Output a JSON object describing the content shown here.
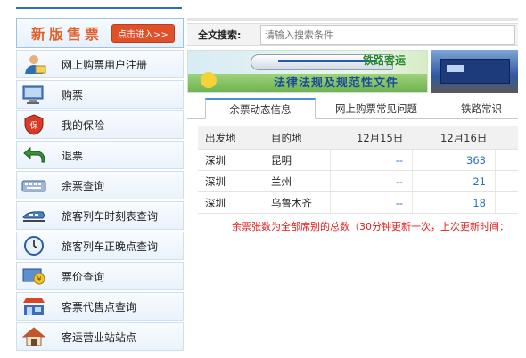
{
  "sidebar": {
    "brand_title": "新版售票",
    "brand_button": "点击进入>>",
    "items": [
      {
        "label": "网上购票用户注册",
        "icon": "user-register-icon"
      },
      {
        "label": "购票",
        "icon": "computer-ticket-icon"
      },
      {
        "label": "我的保险",
        "icon": "insurance-shield-icon"
      },
      {
        "label": "退票",
        "icon": "refund-arrow-icon"
      },
      {
        "label": "余票查询",
        "icon": "keyboard-query-icon"
      },
      {
        "label": "旅客列车时刻表查询",
        "icon": "train-timetable-icon"
      },
      {
        "label": "旅客列车正晚点查询",
        "icon": "clock-icon"
      },
      {
        "label": "票价查询",
        "icon": "price-yen-icon"
      },
      {
        "label": "客票代售点查询",
        "icon": "ticket-agent-store-icon"
      },
      {
        "label": "客运营业站站点",
        "icon": "station-house-icon"
      }
    ]
  },
  "search": {
    "label": "全文搜索:",
    "placeholder": "请输入搜索条件"
  },
  "banner": {
    "tag1": "铁路客运",
    "tag2": "法律法规及规范性文件"
  },
  "tabs": [
    {
      "label": "余票动态信息",
      "active": true
    },
    {
      "label": "网上购票常见问题",
      "active": false
    },
    {
      "label": "铁路常识",
      "active": false
    }
  ],
  "table": {
    "headers": [
      "出发地",
      "目的地",
      "12月15日",
      "12月16日"
    ],
    "rows": [
      [
        "深圳",
        "昆明",
        "--",
        "363"
      ],
      [
        "深圳",
        "兰州",
        "--",
        "21"
      ],
      [
        "深圳",
        "乌鲁木齐",
        "--",
        "18"
      ]
    ]
  },
  "notice": "余票张数为全部席别的总数（30分钟更新一次，上次更新时间：",
  "colors": {
    "accent_blue": "#2a6fb8",
    "brand_orange": "#e0612a",
    "notice_red": "#e21b1b",
    "number_blue": "#2a6fc9"
  }
}
